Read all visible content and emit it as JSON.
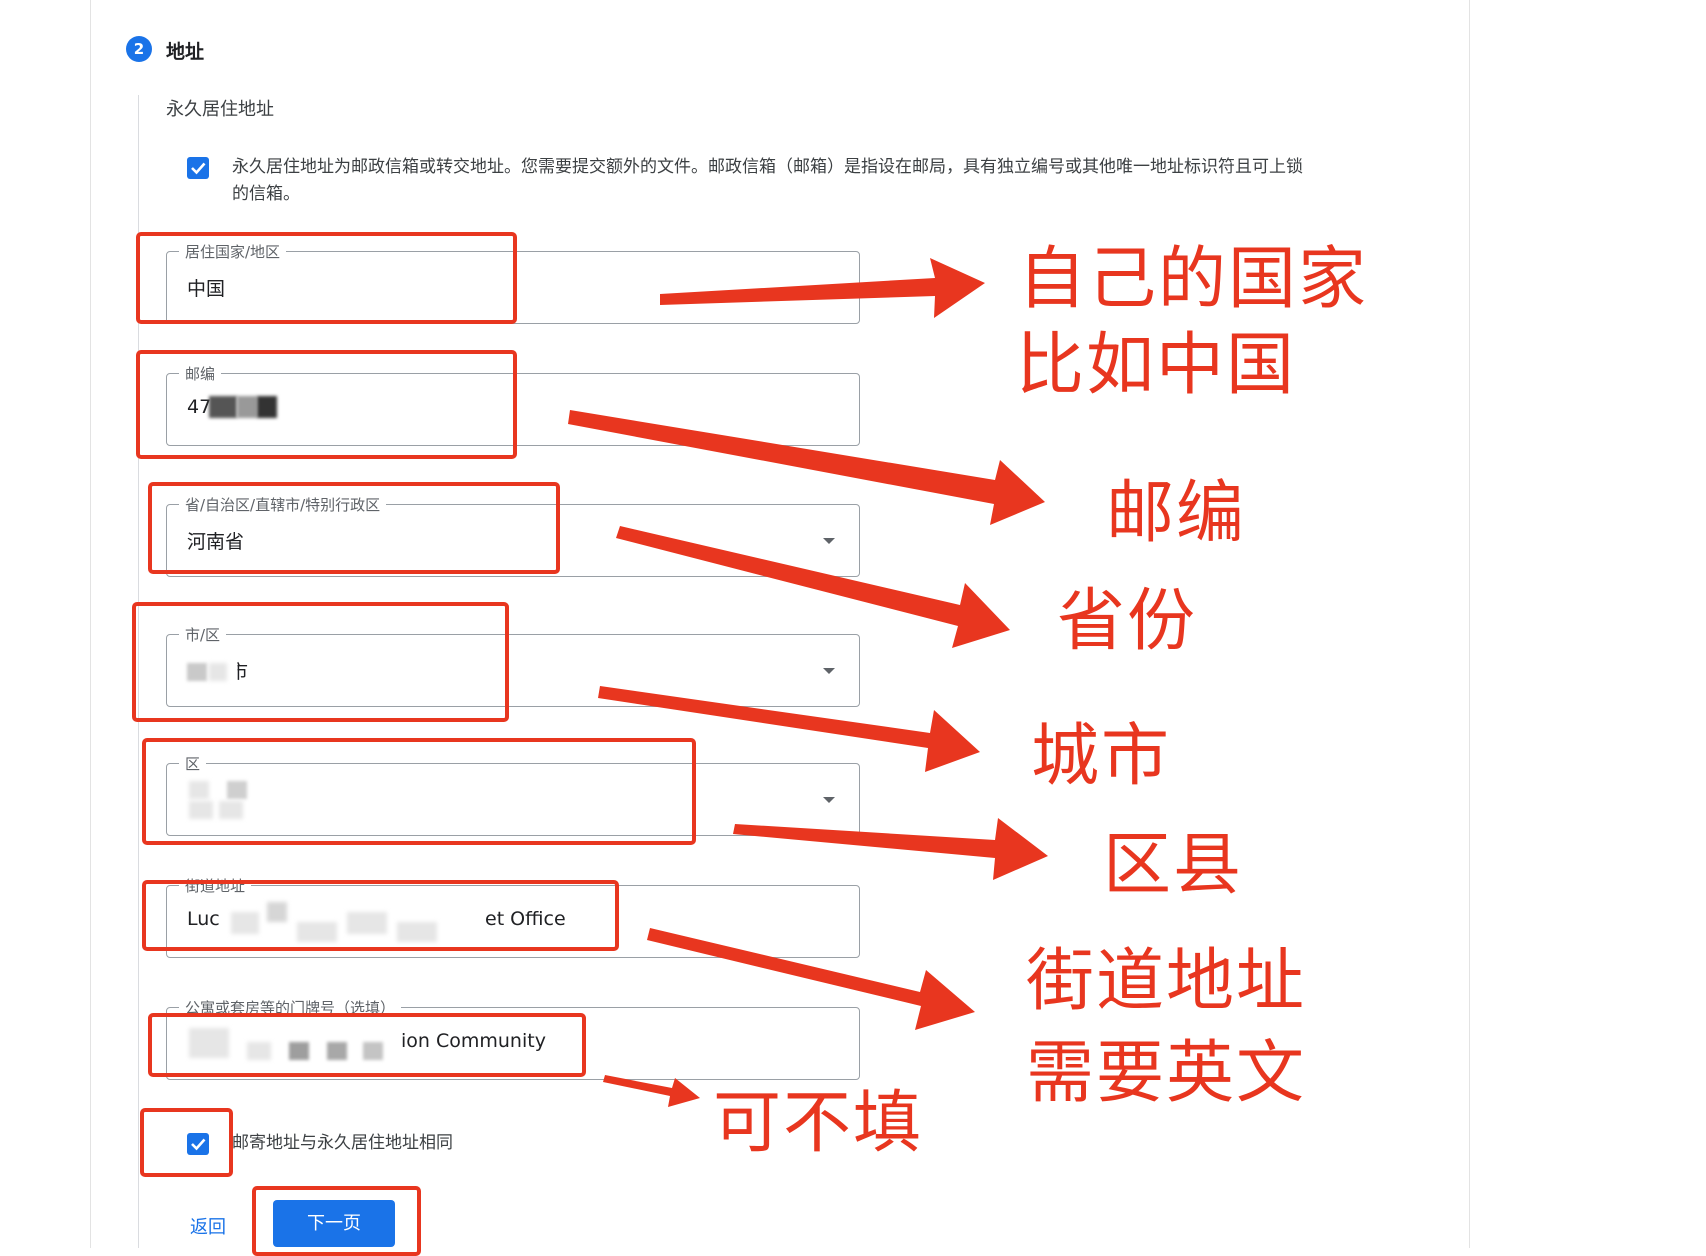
{
  "step": {
    "number": "2",
    "title": "地址"
  },
  "section_label": "永久居住地址",
  "po_box_checkbox": {
    "checked": true,
    "text_line1": "永久居住地址为邮政信箱或转交地址。您需要提交额外的文件。邮政信箱（邮箱）是指设在邮局，具有独立编号或其他唯一地址标识符且可上锁",
    "text_line2": "的信箱。"
  },
  "fields": {
    "country": {
      "label": "居住国家/地区",
      "value": "中国"
    },
    "postal": {
      "label": "邮编",
      "value": "47"
    },
    "province": {
      "label": "省/自治区/直辖市/特别行政区",
      "value": "河南省"
    },
    "city": {
      "label": "市/区",
      "value": "市"
    },
    "district": {
      "label": "区",
      "value": ""
    },
    "street": {
      "label": "街道地址",
      "value_start": "Luc",
      "value_end": "et Office"
    },
    "apartment": {
      "label": "公寓或套房等的门牌号（选填）",
      "value_end": "ion Community"
    }
  },
  "mailing_same_checkbox": {
    "checked": true,
    "text": "邮寄地址与永久居住地址相同"
  },
  "buttons": {
    "back": "返回",
    "next": "下一页"
  },
  "annotations": {
    "country_line1": "自己的国家",
    "country_line2": "比如中国",
    "postal": "邮编",
    "province": "省份",
    "city": "城市",
    "district": "区县",
    "street_line1": "街道地址",
    "street_line2": "需要英文",
    "optional": "可不填"
  },
  "colors": {
    "accent": "#1a73e8",
    "annotation_red": "#e8361f"
  }
}
